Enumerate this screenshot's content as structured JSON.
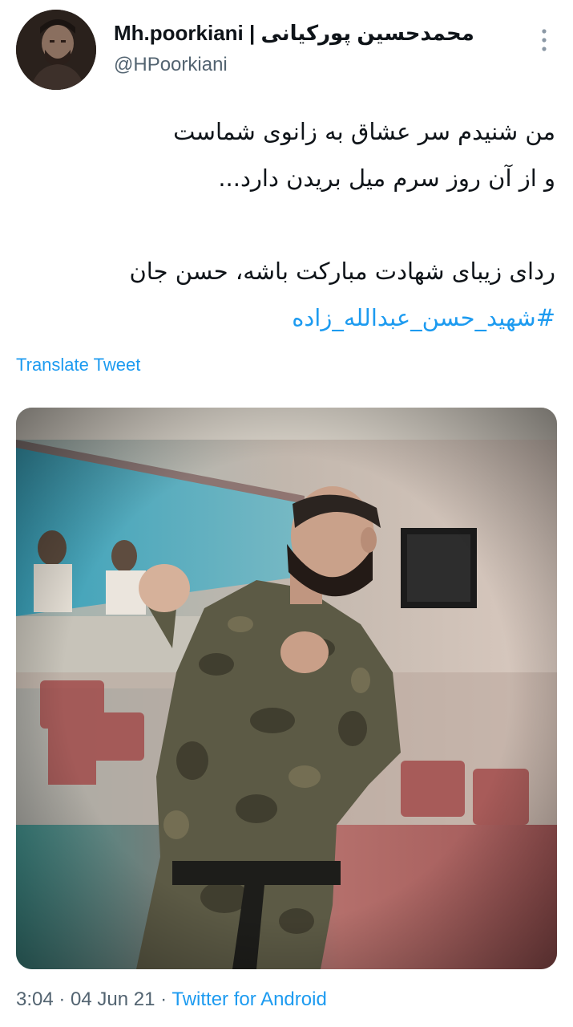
{
  "tweet": {
    "author": {
      "display_name": "Mh.poorkiani | محمدحسین پورکیانی",
      "handle": "@HPoorkiani"
    },
    "more_icon": "more-vertical-icon",
    "body": {
      "line1": "من شنیدم سر عشاق به زانوی شماست",
      "line2": "و از آن روز سرم میل بریدن دارد...",
      "line3": "ردای زیبای شهادت مبارکت باشه، حسن جان",
      "hashtag": "#شهید_حسن_عبدالله_زاده"
    },
    "translate_label": "Translate Tweet",
    "meta": {
      "time": "3:04",
      "separator1": " · ",
      "date": "04 Jun 21",
      "separator2": " · ",
      "source": "Twitter for Android"
    },
    "colors": {
      "link": "#1d9bf0",
      "secondary_text": "#536471",
      "primary_text": "#0f1419"
    }
  }
}
